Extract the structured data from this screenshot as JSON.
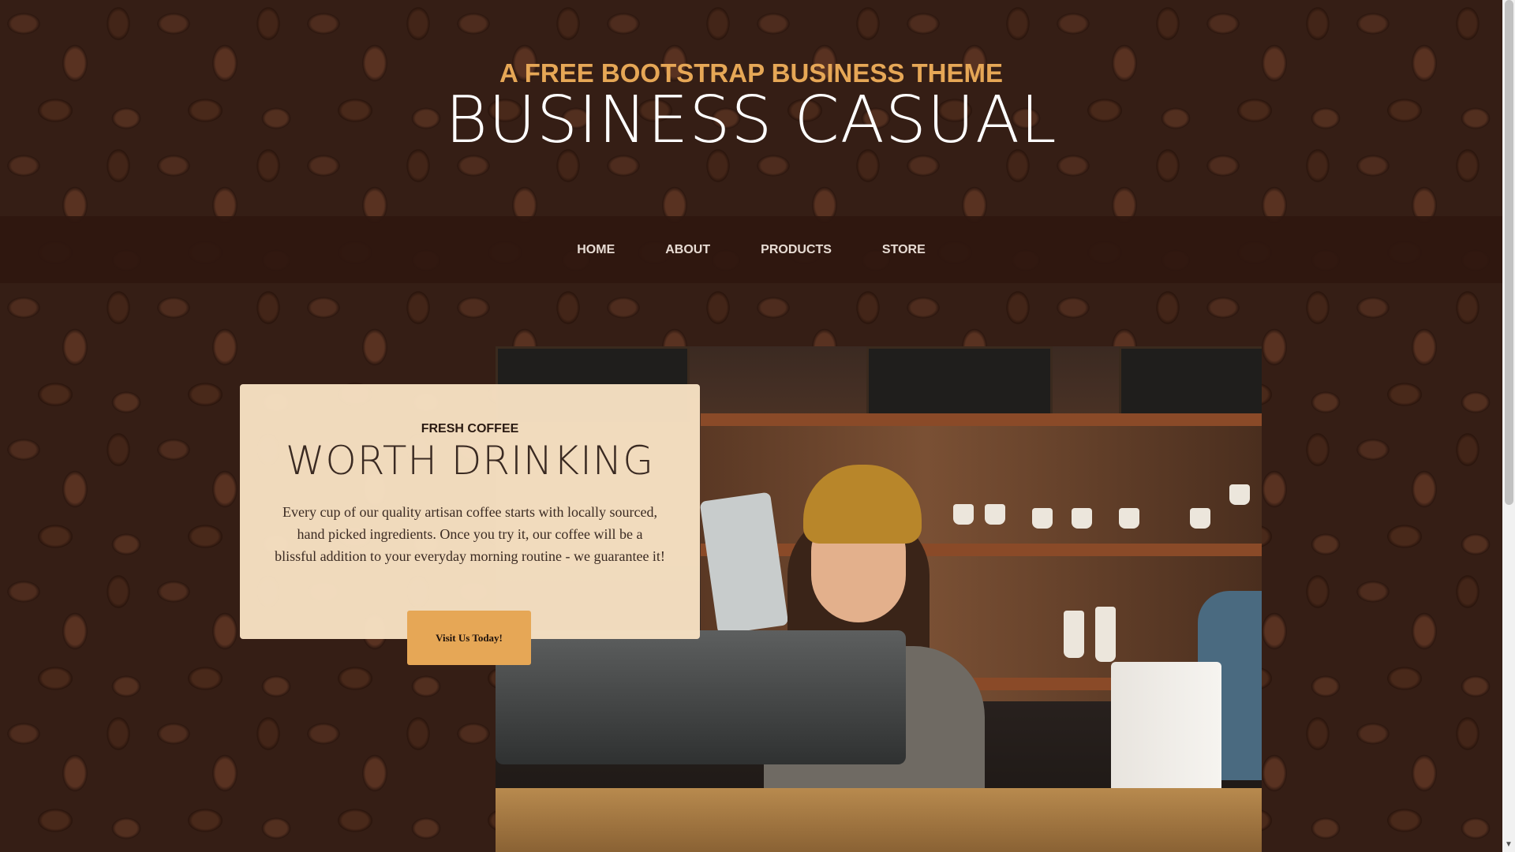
{
  "header": {
    "subtitle": "A FREE BOOTSTRAP BUSINESS THEME",
    "title": "BUSINESS CASUAL"
  },
  "nav": {
    "items": [
      "HOME",
      "ABOUT",
      "PRODUCTS",
      "STORE"
    ]
  },
  "intro": {
    "kicker": "FRESH COFFEE",
    "heading": "WORTH DRINKING",
    "body": "Every cup of our quality artisan coffee starts with locally sourced, hand picked ingredients. Once you try it, our coffee will be a blissful addition to your everyday morning routine - we guarantee it!",
    "cta_label": "Visit Us Today!"
  },
  "colors": {
    "accent": "#e6a756",
    "nav_bg": "#2f170f",
    "card_bg": "#f8e2c4"
  },
  "icons": {
    "scroll_down": "triangle-down"
  }
}
